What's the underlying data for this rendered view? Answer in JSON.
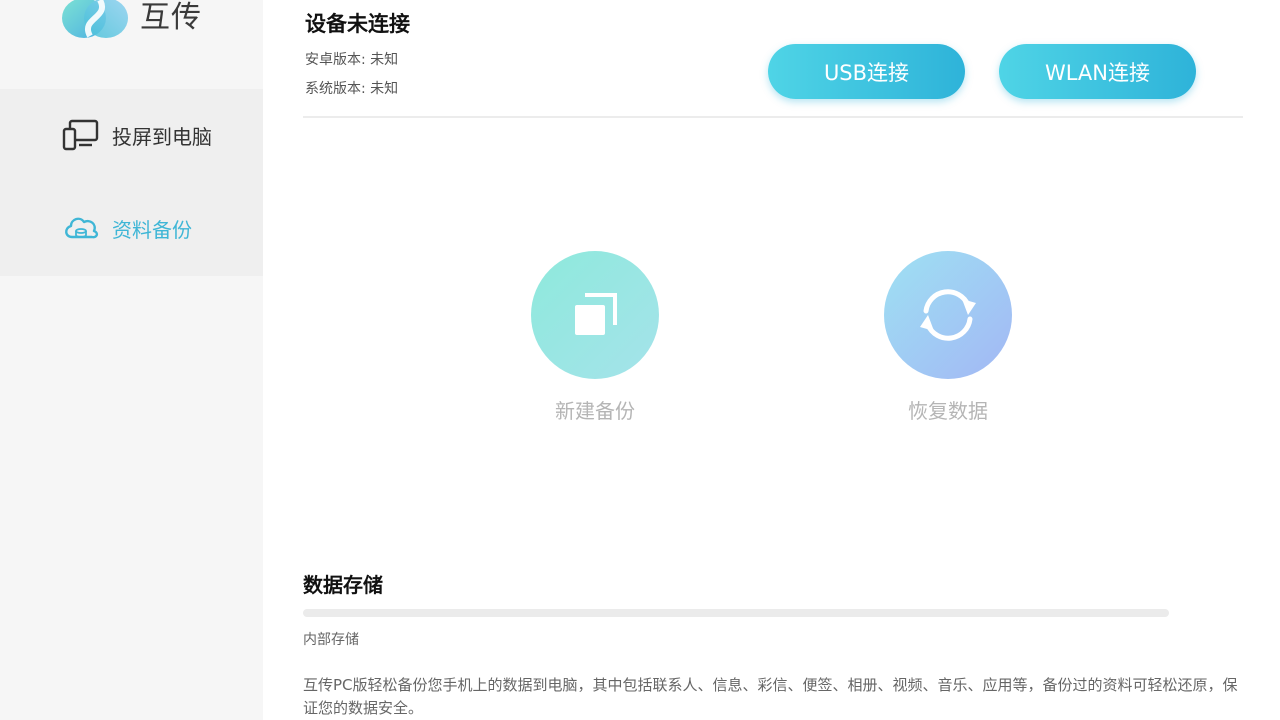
{
  "app": {
    "name": "互传",
    "accent_color": "#3fb6d6"
  },
  "sidebar": {
    "items": [
      {
        "label": "投屏到电脑",
        "icon": "monitor-phone-icon",
        "active": false
      },
      {
        "label": "资料备份",
        "icon": "cloud-backup-icon",
        "active": true
      }
    ]
  },
  "device": {
    "title": "设备未连接",
    "android_version": "安卓版本: 未知",
    "system_version": "系统版本: 未知"
  },
  "connect": {
    "usb_label": "USB连接",
    "wlan_label": "WLAN连接"
  },
  "actions": {
    "new_backup_label": "新建备份",
    "new_backup_icon": "copy-icon",
    "restore_label": "恢复数据",
    "restore_icon": "refresh-icon"
  },
  "storage": {
    "title": "数据存储",
    "label": "内部存储",
    "used_fraction": 0,
    "description": "互传PC版轻松备份您手机上的数据到电脑，其中包括联系人、信息、彩信、便签、相册、视频、音乐、应用等，备份过的资料可轻松还原，保证您的数据安全。"
  }
}
